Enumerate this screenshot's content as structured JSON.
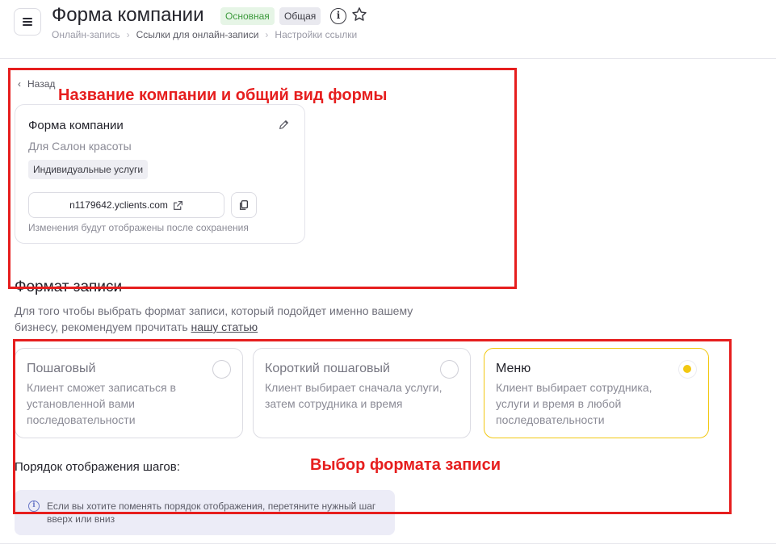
{
  "header": {
    "title": "Форма компании",
    "badge_main": "Основная",
    "badge_common": "Общая",
    "breadcrumbs": [
      "Онлайн-запись",
      "Ссылки для онлайн-записи",
      "Настройки ссылки"
    ]
  },
  "back_label": "Назад",
  "company_card": {
    "name": "Форма компании",
    "subtitle": "Для Салон красоты",
    "tag": "Индивидуальные услуги",
    "link": "n1179642.yclients.com",
    "note": "Изменения будут отображены после сохранения"
  },
  "format_section": {
    "title": "Формат записи",
    "description": "Для того чтобы выбрать формат записи, который подойдет именно вашему бизнесу, рекомендуем прочитать",
    "link_text": "нашу статью",
    "options": [
      {
        "title": "Пошаговый",
        "description": "Клиент сможет записаться в установленной вами последовательности",
        "selected": false
      },
      {
        "title": "Короткий пошаговый",
        "description": "Клиент выбирает сначала услуги, затем сотрудника и время",
        "selected": false
      },
      {
        "title": "Меню",
        "description": "Клиент выбирает сотрудника, услуги и время в любой последовательности",
        "selected": true
      }
    ],
    "steps_label": "Порядок отображения шагов:",
    "info_text": "Если вы хотите поменять порядок отображения, перетяните нужный шаг вверх или вниз"
  },
  "annotations": {
    "top": "Название компании и общий вид формы",
    "bottom": "Выбор формата записи"
  },
  "colors": {
    "accent_yellow": "#f2c812",
    "annotation_red": "#e61e1e",
    "badge_green": "#3d9a3d"
  }
}
